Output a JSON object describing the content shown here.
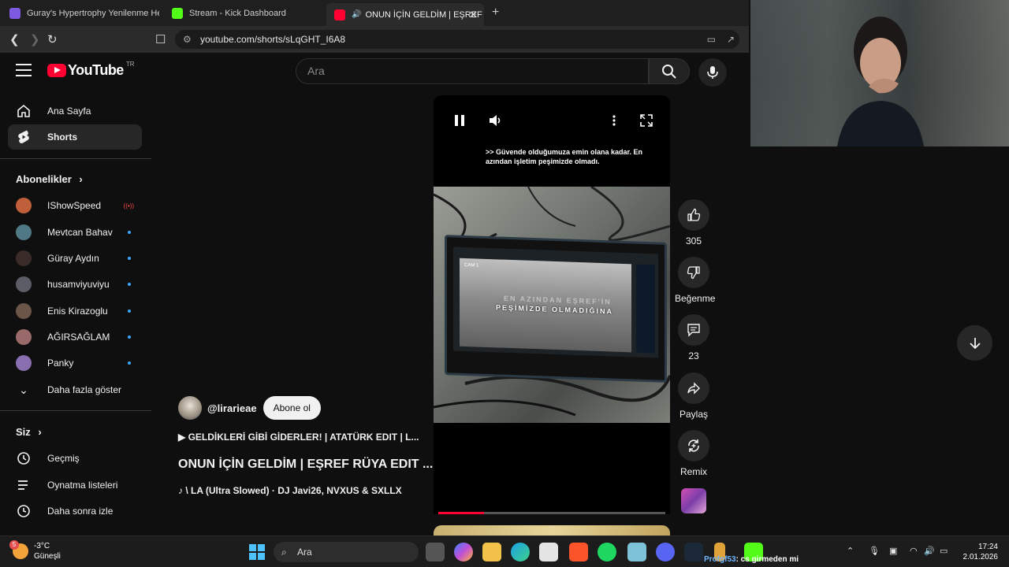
{
  "browser": {
    "tabs": [
      {
        "label": "Guray's Hypertrophy Yenilenme Hedef",
        "color": "#7d5ae0"
      },
      {
        "label": "Stream - Kick Dashboard",
        "color": "#53fc18"
      },
      {
        "label": "ONUN İÇİN GELDİM | EŞREF R",
        "color": "#ff0033"
      }
    ],
    "url": "youtube.com/shorts/sLqGHT_I6A8"
  },
  "header": {
    "logo_text": "YouTube",
    "region": "TR",
    "search_placeholder": "Ara"
  },
  "sidebar": {
    "main": [
      {
        "label": "Ana Sayfa",
        "icon": "home-icon"
      },
      {
        "label": "Shorts",
        "icon": "shorts-icon"
      }
    ],
    "subscriptions_title": "Abonelikler",
    "subscriptions": [
      {
        "label": "IShowSpeed",
        "status": "live",
        "avatar_color": "#c0603a"
      },
      {
        "label": "Mevtcan Bahav",
        "status": "new",
        "avatar_color": "#4f7a85"
      },
      {
        "label": "Güray Aydın",
        "status": "new",
        "avatar_color": "#3a2c28"
      },
      {
        "label": "husamviyuviyu",
        "status": "new",
        "avatar_color": "#5c5c66"
      },
      {
        "label": "Enis Kirazoglu",
        "status": "new",
        "avatar_color": "#6b5548"
      },
      {
        "label": "AĞIRSAĞLAM",
        "status": "new",
        "avatar_color": "#9a6a6a"
      },
      {
        "label": "Panky",
        "status": "new",
        "avatar_color": "#8a6fb0"
      }
    ],
    "show_more": "Daha fazla göster",
    "you_title": "Siz",
    "you_items": [
      {
        "label": "Geçmiş",
        "icon": "history-icon"
      },
      {
        "label": "Oynatma listeleri",
        "icon": "playlist-icon"
      },
      {
        "label": "Daha sonra izle",
        "icon": "clock-icon"
      }
    ]
  },
  "player": {
    "subtitle": ">> Güvende olduğumuza emin olana kadar. En azından işletim peşimizde olmadı.",
    "video_caption_1": "EN AZINDAN EŞREF'İN",
    "video_caption_2": "PEŞİMİZDE OLMADIĞINA",
    "cam_label": "CAM 1",
    "progress": 0.2
  },
  "actions": {
    "likes": "305",
    "dislike_label": "Beğenme",
    "comments": "23",
    "share_label": "Paylaş",
    "remix_label": "Remix"
  },
  "meta": {
    "channel": "@lirarieae",
    "subscribe_label": "Abone ol",
    "description": "▶ GELDİKLERİ GİBİ GİDERLER! | ATATÜRK EDIT | L...",
    "title": "ONUN İÇİN GELDİM | EŞREF RÜYA EDIT ...",
    "music": "♪ \\ LA (Ultra Slowed) · DJ Javi26, NVXUS & SXLLX"
  },
  "taskbar": {
    "temp": "-3°C",
    "weather_label": "Güneşli",
    "weather_badge": "5",
    "search_label": "Ara",
    "chat_user": "Profgf53",
    "chat_message": ": cs girmeden mi",
    "time": "17:24",
    "date": "2.01.2026"
  }
}
